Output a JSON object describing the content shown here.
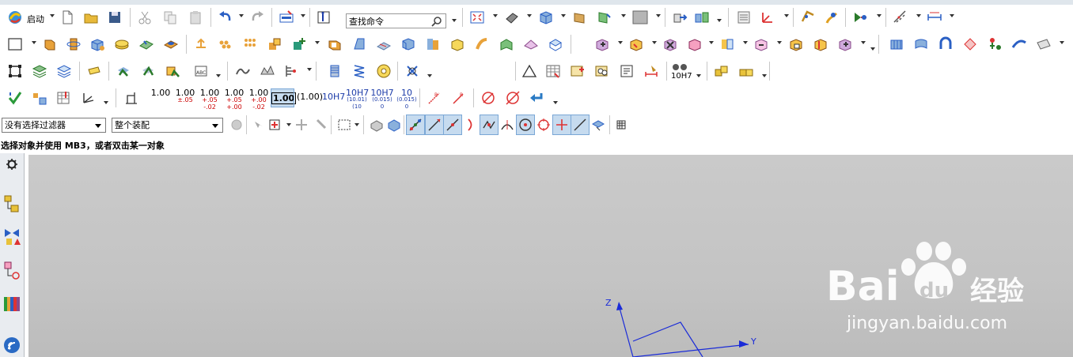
{
  "toolbar_row1": {
    "start_label": "启动",
    "search_placeholder": "查找命令"
  },
  "toolbar_row4": {
    "tolerances": [
      {
        "top": "1.00",
        "bottom": ""
      },
      {
        "top": "1.00",
        "bottom": "±.05"
      },
      {
        "top": "1.00",
        "bottom": "+.05\n-.02"
      },
      {
        "top": "1.00",
        "bottom": "+.05\n+.00"
      },
      {
        "top": "1.00",
        "bottom": "+.00\n-.02"
      },
      {
        "top": "1.00",
        "bottom": "",
        "boxed": true
      },
      {
        "top": "(1.00)",
        "bottom": ""
      },
      {
        "top": "10H7",
        "bottom": ""
      },
      {
        "top": "10H7",
        "bottom": "(10.01)\n(10"
      },
      {
        "top": "10H7",
        "bottom": "(0.015)\n0"
      },
      {
        "top": "10",
        "bottom": "(0.015)\n0"
      }
    ],
    "fit_label": "10H7"
  },
  "toolbar_row5": {
    "filter_select": "没有选择过滤器",
    "assembly_select": "整个装配"
  },
  "status_bar": {
    "message": "选择对象并使用 MB3，或者双击某一对象"
  },
  "viewport": {
    "axes": {
      "z": "Z",
      "y": "Y"
    },
    "watermark": {
      "main": "Bai",
      "du": "du",
      "cn": "经验",
      "url": "jingyan.baidu.com"
    }
  },
  "colors": {
    "axis": "#1a2bd8",
    "viewport_bg": "#c6c6c6",
    "red_text": "#cc0000",
    "blue_text": "#1a3aa8"
  }
}
